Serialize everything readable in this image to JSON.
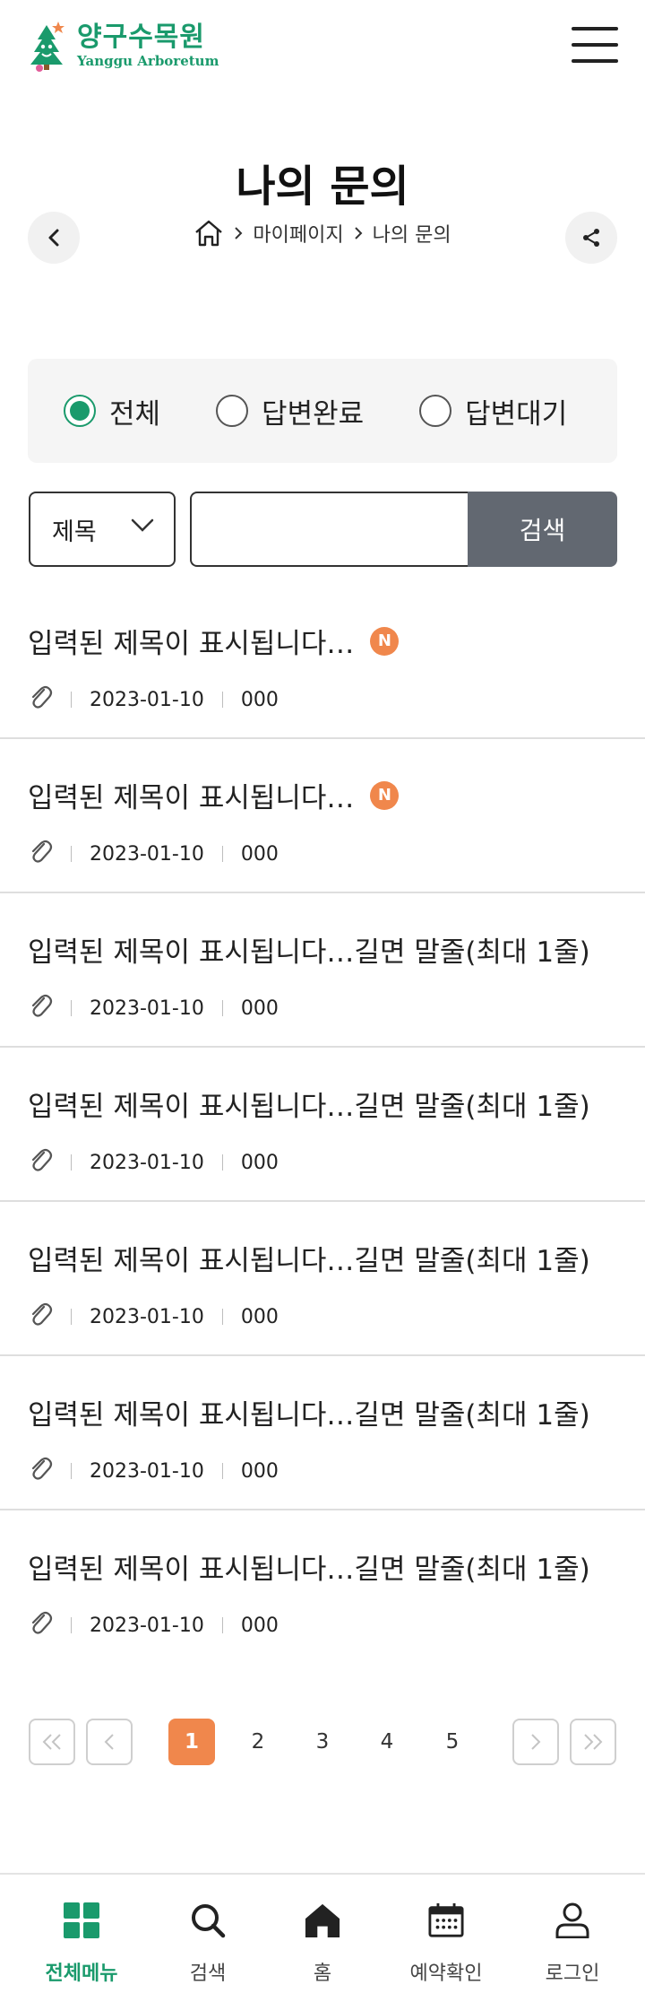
{
  "header": {
    "logo_korean": "양구수목원",
    "logo_english": "Yanggu Arboretum",
    "menu_icon": "hamburger-icon"
  },
  "page": {
    "title": "나의 문의"
  },
  "breadcrumb": {
    "items": [
      "마이페이지",
      "나의 문의"
    ],
    "home_icon": "home-icon"
  },
  "filter": {
    "options": [
      {
        "label": "전체",
        "checked": true
      },
      {
        "label": "답변완료",
        "checked": false
      },
      {
        "label": "답변대기",
        "checked": false
      }
    ]
  },
  "search": {
    "field_selected": "제목",
    "input_value": "",
    "button_label": "검색"
  },
  "list": {
    "new_badge": "N",
    "items": [
      {
        "title": "입력된 제목이 표시됩니다…",
        "is_new": true,
        "date": "2023-01-10",
        "author": "000"
      },
      {
        "title": "입력된 제목이 표시됩니다…",
        "is_new": true,
        "date": "2023-01-10",
        "author": "000"
      },
      {
        "title": "입력된 제목이 표시됩니다…길면 말줄(최대 1줄)",
        "is_new": false,
        "date": "2023-01-10",
        "author": "000"
      },
      {
        "title": "입력된 제목이 표시됩니다…길면 말줄(최대 1줄)",
        "is_new": false,
        "date": "2023-01-10",
        "author": "000"
      },
      {
        "title": "입력된 제목이 표시됩니다…길면 말줄(최대 1줄)",
        "is_new": false,
        "date": "2023-01-10",
        "author": "000"
      },
      {
        "title": "입력된 제목이 표시됩니다…길면 말줄(최대 1줄)",
        "is_new": false,
        "date": "2023-01-10",
        "author": "000"
      },
      {
        "title": "입력된 제목이 표시됩니다…길면 말줄(최대 1줄)",
        "is_new": false,
        "date": "2023-01-10",
        "author": "000"
      }
    ]
  },
  "pagination": {
    "pages": [
      "1",
      "2",
      "3",
      "4",
      "5"
    ],
    "current": "1"
  },
  "bottom_nav": {
    "items": [
      {
        "label": "전체메뉴",
        "icon": "grid-icon",
        "active": true
      },
      {
        "label": "검색",
        "icon": "search-icon",
        "active": false
      },
      {
        "label": "홈",
        "icon": "home-icon",
        "active": false
      },
      {
        "label": "예약확인",
        "icon": "calendar-icon",
        "active": false
      },
      {
        "label": "로그인",
        "icon": "user-icon",
        "active": false
      }
    ]
  },
  "colors": {
    "brand_green": "#1a9a6c",
    "accent_orange": "#f0874c",
    "search_button": "#626871"
  }
}
